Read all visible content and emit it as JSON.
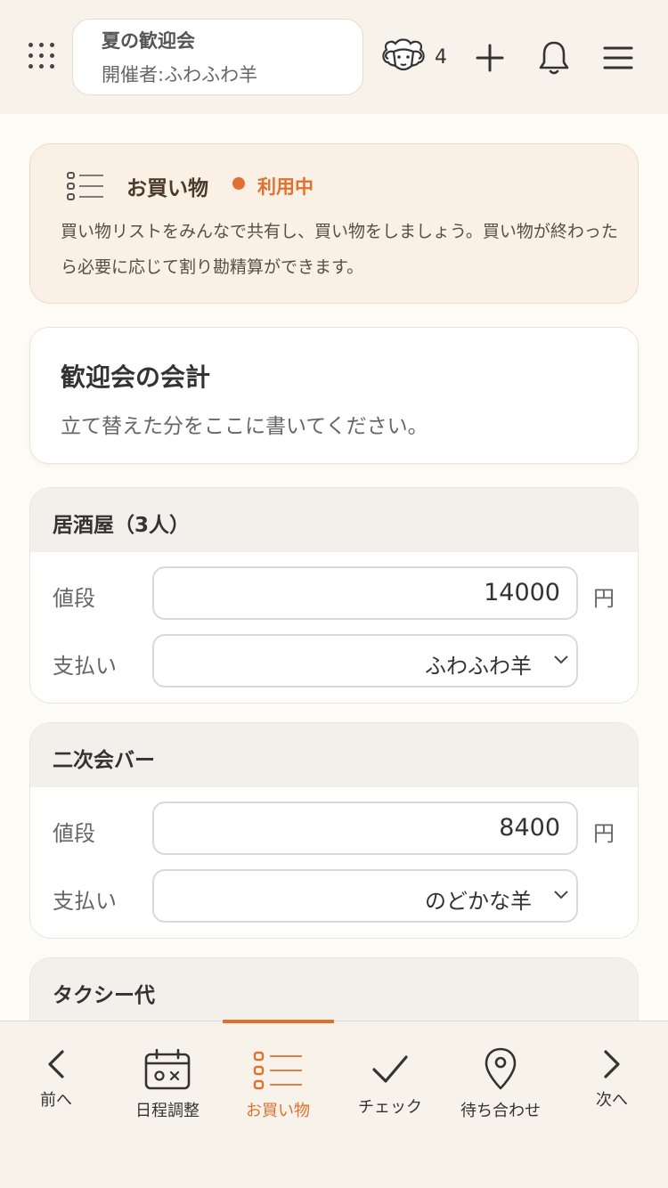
{
  "header": {
    "event_title": "夏の歓迎会",
    "event_host": "開催者:ふわふわ羊",
    "member_count": "4"
  },
  "info_card": {
    "title": "お買い物",
    "status": "利用中",
    "description": "買い物リストをみんなで共有し、買い物をしましょう。買い物が終わったら必要に応じて割り勘精算ができます。"
  },
  "note_card": {
    "title": "歓迎会の会計",
    "text": "立て替えた分をここに書いてください。"
  },
  "items": [
    {
      "name": "居酒屋（3人）",
      "price_label": "値段",
      "price": "14000",
      "unit": "円",
      "payer_label": "支払い",
      "payer": "ふわふわ羊"
    },
    {
      "name": "二次会バー",
      "price_label": "値段",
      "price": "8400",
      "unit": "円",
      "payer_label": "支払い",
      "payer": "のどかな羊"
    },
    {
      "name": "タクシー代"
    }
  ],
  "nav": {
    "prev": "前へ",
    "schedule": "日程調整",
    "shopping": "お買い物",
    "check": "チェック",
    "meetup": "待ち合わせ",
    "next": "次へ"
  },
  "colors": {
    "accent": "#e07030",
    "header_bg": "#f7f3ea",
    "page_bg": "#fdfbf5"
  }
}
